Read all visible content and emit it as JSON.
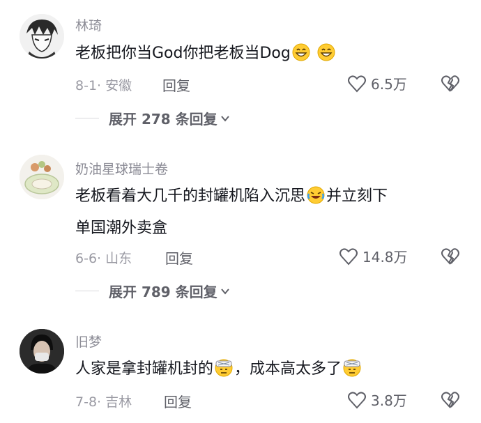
{
  "comments": [
    {
      "username": "林琦",
      "avatar_icon": "anime-character-avatar",
      "text_parts": [
        "老板把你当God你把老板当Dog",
        ""
      ],
      "emojis": [
        "grinning-face-emoji",
        "grinning-face-emoji"
      ],
      "date_location": "8-1· 安徽",
      "reply_label": "回复",
      "likes": "6.5万",
      "expand_replies": "展开 278 条回复"
    },
    {
      "username": "奶油星球瑞士卷",
      "avatar_icon": "swiss-roll-cake-avatar",
      "text_line1_before": "老板看着大几千的封罐机陷入沉思",
      "text_line1_after": "并立刻下",
      "text_line2": "单国潮外卖盒",
      "emoji": "laughing-crying-emoji",
      "date_location": "6-6· 山东",
      "reply_label": "回复",
      "likes": "14.8万",
      "expand_replies": "展开 789 条回复"
    },
    {
      "username": "旧梦",
      "avatar_icon": "masked-person-avatar",
      "text_before": "人家是拿封罐机封的",
      "text_after": "，成本高太多了",
      "emoji": "bandaged-face-emoji",
      "date_location": "7-8· 吉林",
      "reply_label": "回复",
      "likes": "3.8万"
    }
  ],
  "colors": {
    "text": "#16181f",
    "secondary": "#8c8c96",
    "action": "#5f6068"
  }
}
